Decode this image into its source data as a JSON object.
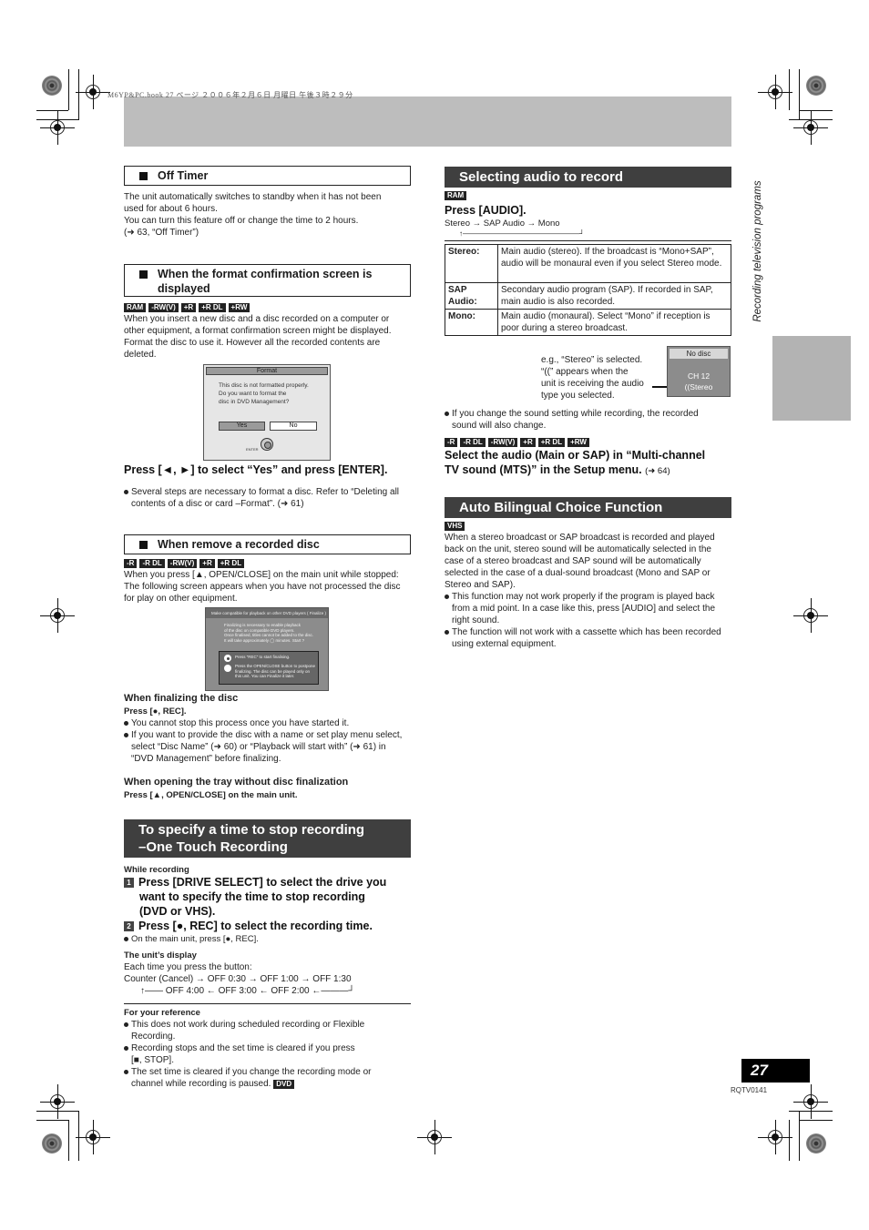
{
  "header": {
    "print_line": "M6YP&PC.book  27 ページ  ２００６年２月６日  月曜日  午後３時２９分"
  },
  "side_label": "Recording television programs",
  "left": {
    "off_timer": {
      "heading": "Off Timer",
      "body": [
        "The unit automatically switches to standby when it has not been",
        "used for about 6 hours.",
        "You can turn this feature off or change the time to 2 hours.",
        "(➜ 63, “Off Timer”)"
      ]
    },
    "format_confirm": {
      "heading_line1": "When the format confirmation screen is",
      "heading_line2": "displayed",
      "disc_tags": [
        "RAM",
        "-RW(V)",
        "+R",
        "+R DL",
        "+RW"
      ],
      "body": [
        "When you insert a new disc and a disc recorded on a computer or",
        "other equipment, a format confirmation screen might be displayed.",
        "Format the disc to use it. However all the recorded contents are",
        "deleted."
      ],
      "dialog": {
        "title": "Format",
        "message": [
          "This disc is not formatted properly.",
          "Do you want to format the",
          "disc in DVD Management?"
        ],
        "yes_label": "Yes",
        "no_label": "No",
        "enter_label": "ENTER"
      },
      "instruction": "Press [◄, ►] to select “Yes” and press [ENTER].",
      "note_line1": "Several steps are necessary to format a disc. Refer to “Deleting all",
      "note_line2": "contents of a disc or card –Format”. (➜ 61)"
    },
    "remove_disc": {
      "heading": "When remove a recorded disc",
      "disc_tags": [
        "-R",
        "-R DL",
        "-RW(V)",
        "+R",
        "+R DL"
      ],
      "body": [
        "When you press [▲, OPEN/CLOSE] on the main unit while stopped:",
        "The following screen appears when you have not processed the disc",
        "for play on other equipment."
      ],
      "dialog": {
        "title": "Make compatible for playback on other DVD players ( Finalize )",
        "message": [
          "Finalizing is necessary to enable playback",
          "of the disc on compatible DVD players.",
          "Once finalised, titles cannot be added to the disc.",
          "It will take approximately ◯ minutes. Start ?"
        ],
        "option1": "Press “REC” to start finalising.",
        "option2": [
          "Press the OPEN/CLOSE button to postpone",
          "finalizing. The disc can be played only on",
          "this unit. You can Finalize it later."
        ]
      },
      "finalizing_heading": "When finalizing the disc",
      "finalizing_press": "Press [●, REC].",
      "finalizing_note1": "You cannot stop this process once you have started it.",
      "finalizing_note2": [
        "If you want to provide the disc with a name or set play menu select,",
        "select “Disc Name” (➜ 60) or “Playback will start with” (➜ 61) in",
        "“DVD Management” before finalizing."
      ],
      "tray_heading": "When opening the tray without disc finalization",
      "tray_press": "Press [▲, OPEN/CLOSE] on the main unit."
    },
    "one_touch": {
      "banner_line1": "To specify a time to stop recording",
      "banner_line2": "–One Touch Recording",
      "while_recording": "While recording",
      "step1_num": "1",
      "step1": [
        "Press [DRIVE SELECT] to select the drive you",
        "want to specify the time to stop recording",
        "(DVD or VHS)."
      ],
      "step2_num": "2",
      "step2": "Press [●, REC] to select the recording time.",
      "step2_note": "On the main unit, press [●, REC].",
      "display_heading": "The unit’s display",
      "display_intro": "Each time you press the button:",
      "cycle_line1": "Counter (Cancel) → OFF 0:30 → OFF 1:00 → OFF 1:30",
      "cycle_line2": "↑—— OFF 4:00 ← OFF 3:00 ← OFF 2:00 ←———┘",
      "reference_heading": "For your reference",
      "reference_notes": [
        [
          "This does not work during scheduled recording or Flexible",
          "Recording."
        ],
        [
          "Recording stops and the set time is cleared if you press",
          "[■, STOP]."
        ],
        [
          "The set time is cleared if you change the recording mode or",
          "channel while recording is paused."
        ]
      ],
      "reference_tag": "DVD"
    }
  },
  "right": {
    "selecting_audio": {
      "banner": "Selecting audio to record",
      "disc_tag": "RAM",
      "instruction": "Press [AUDIO].",
      "cycle_line1": "Stereo → SAP Audio → Mono",
      "cycle_line2": "↑————————————————┘",
      "table": [
        {
          "key": "Stereo:",
          "value": "Main audio (stereo). If the broadcast is “Mono+SAP”, audio will be monaural even if you select Stereo mode."
        },
        {
          "key": "SAP Audio:",
          "value": "Secondary audio program (SAP). If recorded in SAP, main audio is also recorded."
        },
        {
          "key": "Mono:",
          "value": "Main audio (monaural). Select “Mono” if reception is poor during a stereo broadcast."
        }
      ],
      "example_text": [
        "e.g., “Stereo” is selected.",
        "“((” appears when the",
        "unit is receiving the audio",
        "type you selected."
      ],
      "display": {
        "top": "No disc",
        "channel": "CH 12",
        "audio": "((Stereo"
      },
      "note": [
        "If you change the sound setting while recording, the recorded",
        "sound will also change."
      ],
      "mts_tags": [
        "-R",
        "-R DL",
        "-RW(V)",
        "+R",
        "+R DL",
        "+RW"
      ],
      "mts_instruction_line1": "Select the audio (Main or SAP) in “Multi-channel",
      "mts_instruction_line2": "TV sound (MTS)” in the Setup menu.",
      "mts_ref": "(➜ 64)"
    },
    "auto_bilingual": {
      "banner": "Auto Bilingual Choice Function",
      "disc_tag": "VHS",
      "body": [
        "When a stereo broadcast or SAP broadcast is recorded and played",
        "back on the unit, stereo sound will be automatically selected in the",
        "case of a stereo broadcast and SAP sound will be automatically",
        "selected in the case of a dual-sound broadcast (Mono and SAP or",
        "Stereo and SAP)."
      ],
      "notes": [
        [
          "This function may not work properly if the program is played back",
          "from a mid point. In a case like this, press [AUDIO] and select the",
          "right sound."
        ],
        [
          "The function will not work with a cassette which has been recorded",
          "using external equipment."
        ]
      ]
    }
  },
  "footer": {
    "page_number": "27",
    "doc_code": "RQTV0141"
  }
}
